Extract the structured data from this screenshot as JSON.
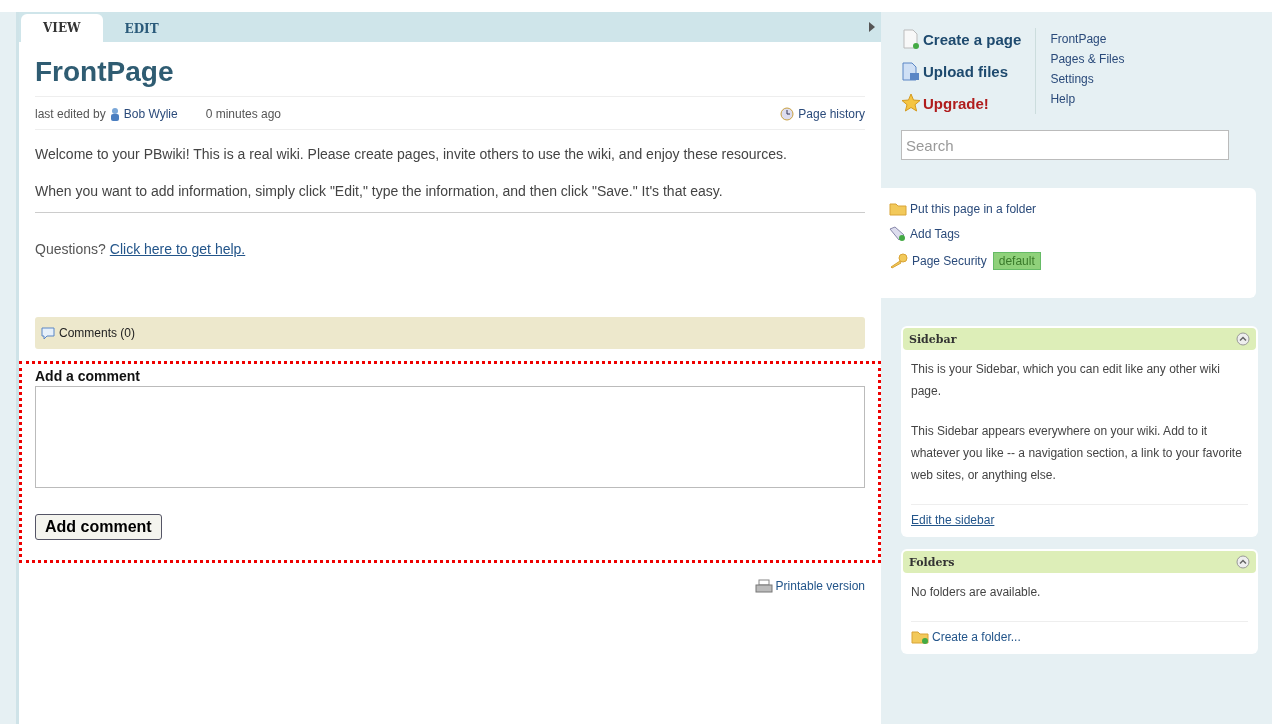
{
  "tabs": [
    {
      "label": "VIEW",
      "selected": true
    },
    {
      "label": "EDIT",
      "selected": false
    }
  ],
  "page": {
    "title": "FrontPage",
    "edited_by_label": "last edited by",
    "author": "Bob Wylie",
    "edited_time": "0 minutes ago",
    "history_link": "Page history",
    "paragraphs": [
      "Welcome to your PBwiki!  This is a real wiki.  Please create pages, invite others to use the wiki, and enjoy these resources.",
      "When you want to add information, simply click \"Edit,\" type the information, and then click \"Save.\"  It's that easy."
    ],
    "questions": "Questions?",
    "help_link": "Click here to get help.",
    "comments_label": "Comments (0)",
    "add_comment": {
      "heading": "Add a comment",
      "button": "Add comment"
    },
    "printable_link": "Printable version"
  },
  "actions": [
    {
      "kind": "create",
      "label": "Create a page"
    },
    {
      "kind": "upload",
      "label": "Upload files"
    },
    {
      "kind": "upgrade",
      "label": "Upgrade!"
    }
  ],
  "nav_links": [
    "FrontPage",
    "Pages & Files",
    "Settings",
    "Help"
  ],
  "search": {
    "placeholder": "Search"
  },
  "page_tools": [
    {
      "kind": "folder",
      "label": "Put this page in a folder"
    },
    {
      "kind": "tags",
      "label": "Add Tags"
    },
    {
      "kind": "security",
      "label": "Page Security",
      "badge": "default"
    }
  ],
  "panels": [
    {
      "title": "Sidebar",
      "expanded": true,
      "paragraphs": [
        "This is your Sidebar, which you can edit like any other wiki page.",
        "This Sidebar appears everywhere on your wiki. Add to it whatever you like -- a navigation section, a link to your favorite web sites, or anything else."
      ],
      "link": {
        "kind": "plain",
        "label": "Edit the sidebar"
      }
    },
    {
      "title": "Folders",
      "expanded": true,
      "paragraphs": [
        "No folders are available."
      ],
      "link": {
        "kind": "folder",
        "label": "Create a folder..."
      }
    }
  ]
}
